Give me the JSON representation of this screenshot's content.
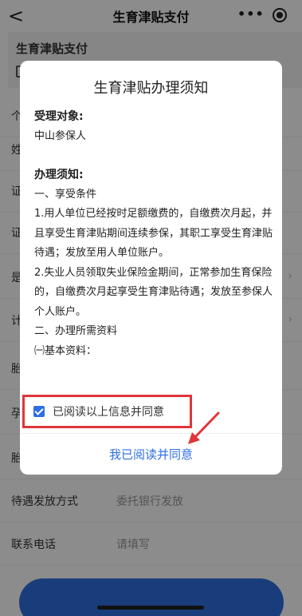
{
  "navbar": {
    "back_glyph": "<",
    "title": "生育津贴支付",
    "more_glyph": "•••"
  },
  "background": {
    "section_title": "生育津贴支付",
    "rows": [
      {
        "label": "个",
        "value": ""
      },
      {
        "label": "姓",
        "value": ""
      },
      {
        "label": "证",
        "value": ""
      },
      {
        "label": "证",
        "value": ""
      },
      {
        "label": "是",
        "value": ""
      },
      {
        "label": "计",
        "value": ""
      },
      {
        "label": "胎",
        "value": ""
      },
      {
        "label": "孕",
        "value": ""
      },
      {
        "label": "胎",
        "value": ""
      },
      {
        "label": "待遇发放方式",
        "value": "委托银行发放"
      },
      {
        "label": "联系电话",
        "value": "请填写"
      }
    ],
    "chevron": "›"
  },
  "modal": {
    "title": "生育津贴办理须知",
    "target_heading": "受理对象:",
    "target_value": "中山参保人",
    "notice_heading": "办理须知:",
    "lines": [
      "一、享受条件",
      "1.用人单位已经按时足额缴费的，自缴费次月起，并且享受生育津贴期间连续参保，其职工享受生育津贴待遇；发放至用人单位账户。",
      "2.失业人员领取失业保险金期间，正常参加生育保险的，自缴费次月起享受生育津贴待遇；发放至参保人个人账户。",
      "二、办理所需资料",
      "㈠基本资料："
    ],
    "agree_label": "已阅读以上信息并同意",
    "agree_checked": true,
    "confirm_label": "我已阅读并同意"
  },
  "colors": {
    "accent": "#2f6fe0",
    "highlight": "#e0353a"
  }
}
